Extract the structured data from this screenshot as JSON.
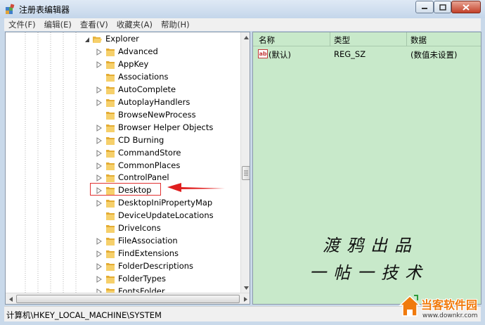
{
  "window": {
    "title": "注册表编辑器",
    "minimize_glyph": "─",
    "maximize_glyph": "□",
    "close_glyph": "✕"
  },
  "menu": [
    "文件(F)",
    "编辑(E)",
    "查看(V)",
    "收藏夹(A)",
    "帮助(H)"
  ],
  "tree": {
    "parent": "Explorer",
    "children": [
      {
        "label": "Advanced",
        "expandable": true
      },
      {
        "label": "AppKey",
        "expandable": true
      },
      {
        "label": "Associations",
        "expandable": false
      },
      {
        "label": "AutoComplete",
        "expandable": true
      },
      {
        "label": "AutoplayHandlers",
        "expandable": true
      },
      {
        "label": "BrowseNewProcess",
        "expandable": false
      },
      {
        "label": "Browser Helper Objects",
        "expandable": true
      },
      {
        "label": "CD Burning",
        "expandable": true
      },
      {
        "label": "CommandStore",
        "expandable": true
      },
      {
        "label": "CommonPlaces",
        "expandable": true
      },
      {
        "label": "ControlPanel",
        "expandable": true
      },
      {
        "label": "Desktop",
        "expandable": true,
        "highlighted": true
      },
      {
        "label": "DesktopIniPropertyMap",
        "expandable": true
      },
      {
        "label": "DeviceUpdateLocations",
        "expandable": false
      },
      {
        "label": "DriveIcons",
        "expandable": false
      },
      {
        "label": "FileAssociation",
        "expandable": true
      },
      {
        "label": "FindExtensions",
        "expandable": true
      },
      {
        "label": "FolderDescriptions",
        "expandable": true
      },
      {
        "label": "FolderTypes",
        "expandable": true
      },
      {
        "label": "FontsFolder",
        "expandable": true
      }
    ]
  },
  "list": {
    "columns": [
      "名称",
      "类型",
      "数据"
    ],
    "rows": [
      {
        "icon": "string-value-icon",
        "icon_text": "ab",
        "name": "(默认)",
        "type": "REG_SZ",
        "data": "(数值未设置)"
      }
    ]
  },
  "watermark": {
    "line1": "渡鸦出品",
    "line2": "一帖一技术"
  },
  "status": {
    "path": "计算机\\HKEY_LOCAL_MACHINE\\SYSTEM"
  },
  "site_logo": {
    "name": "当客软件园",
    "url": "www.downkr.com"
  },
  "colors": {
    "list_background": "#c8e9ca",
    "highlight": "#e23232",
    "folder": "#f2c24f"
  }
}
